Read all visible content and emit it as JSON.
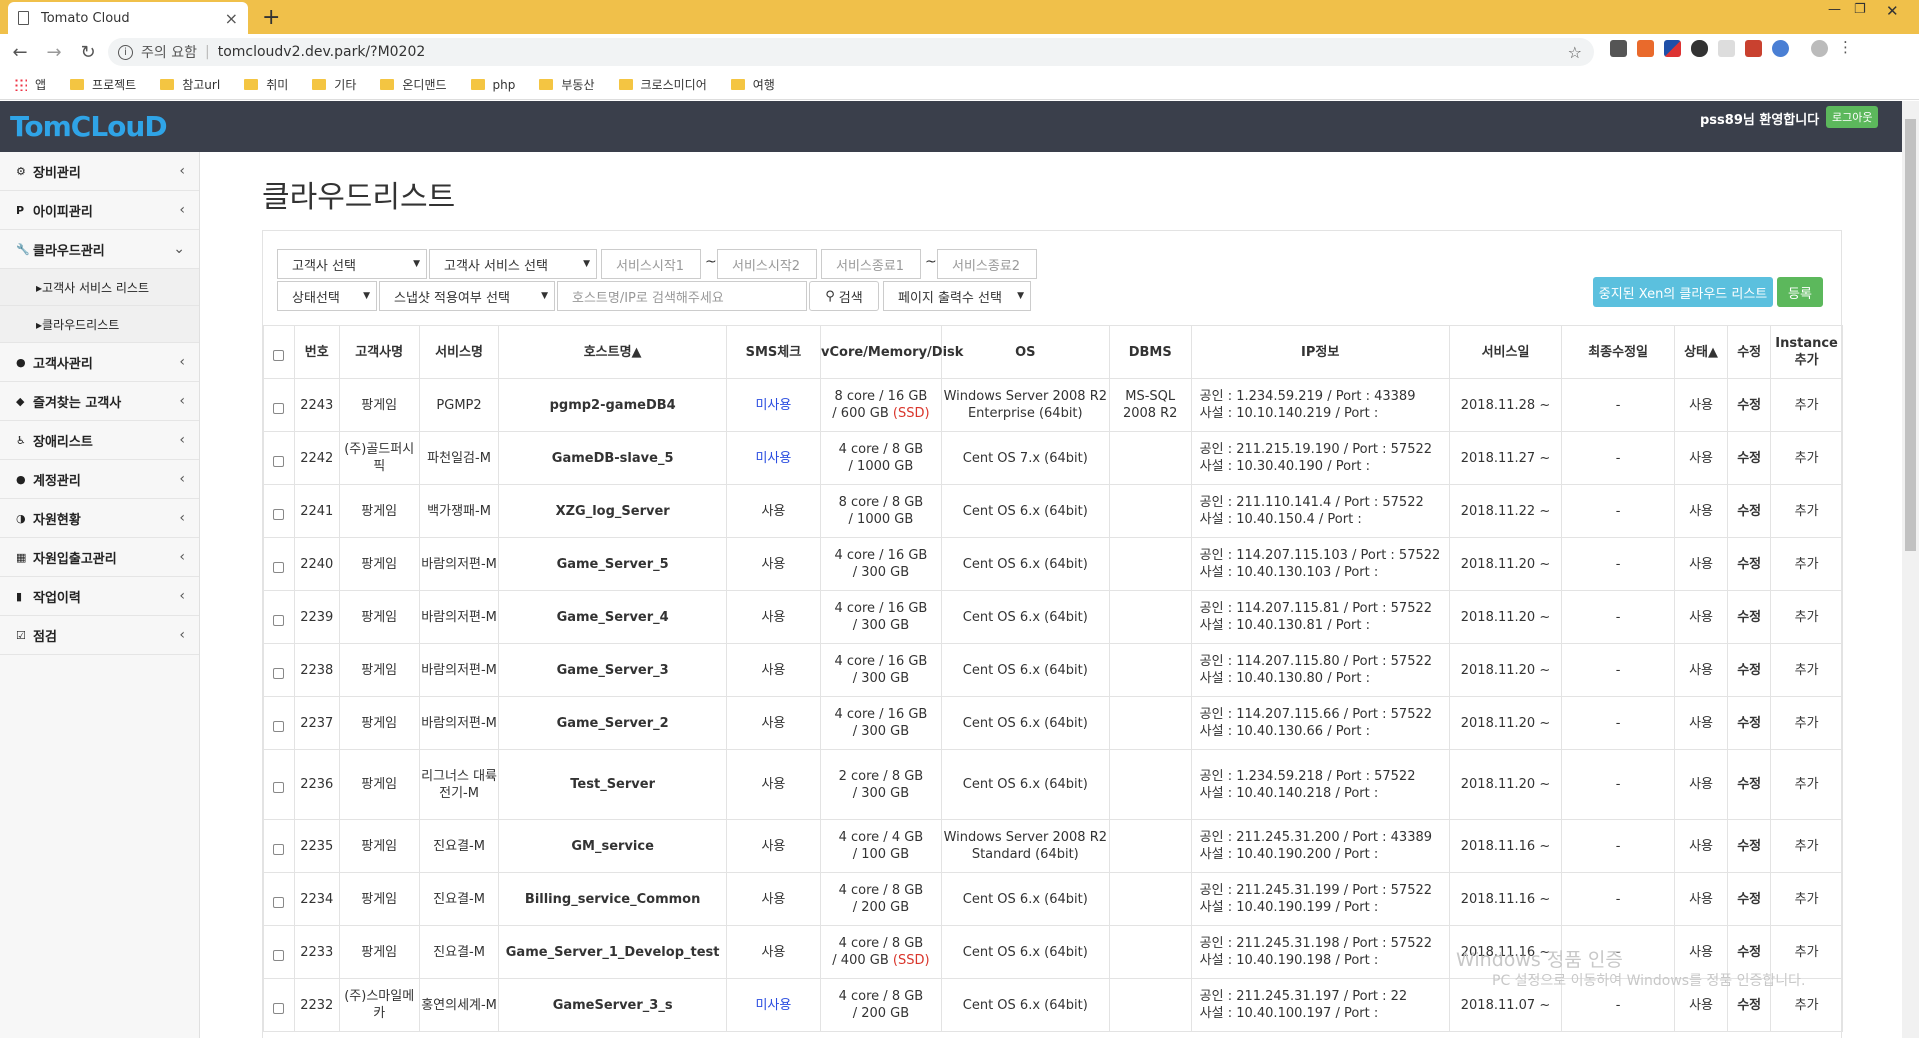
{
  "browser": {
    "tab_title": "Tomato Cloud",
    "omnibox": {
      "warning": "주의 요함",
      "url": "tomcloudv2.dev.park/?M0202"
    },
    "bookmarks": [
      "앱",
      "프로젝트",
      "참고url",
      "취미",
      "기타",
      "온디맨드",
      "php",
      "부동산",
      "크로스미디어",
      "여행"
    ]
  },
  "header": {
    "logo": "TomCLouD",
    "welcome": "pss89님 환영합니다",
    "logout": "로그아웃"
  },
  "sidebar": {
    "items": [
      {
        "icon": "gear-icon",
        "glyph": "⚙",
        "label": "장비관리",
        "chev": "‹"
      },
      {
        "icon": "ip-icon",
        "glyph": "P",
        "label": "아이피관리",
        "chev": "‹"
      },
      {
        "icon": "wrench-icon",
        "glyph": "🔧",
        "label": "클라우드관리",
        "chev": "⌄"
      },
      {
        "icon": "user-icon",
        "glyph": "●",
        "label": "고객사관리",
        "chev": "‹"
      },
      {
        "icon": "cube-icon",
        "glyph": "◆",
        "label": "즐겨찾는 고객사",
        "chev": "‹"
      },
      {
        "icon": "wheelchair-icon",
        "glyph": "♿",
        "label": "장애리스트",
        "chev": "‹"
      },
      {
        "icon": "account-icon",
        "glyph": "●",
        "label": "계정관리",
        "chev": "‹"
      },
      {
        "icon": "pie-icon",
        "glyph": "◑",
        "label": "자원현황",
        "chev": "‹"
      },
      {
        "icon": "calendar-icon",
        "glyph": "▦",
        "label": "자원입출고관리",
        "chev": "‹"
      },
      {
        "icon": "book-icon",
        "glyph": "▮",
        "label": "작업이력",
        "chev": "‹"
      },
      {
        "icon": "check-icon",
        "glyph": "☑",
        "label": "점검",
        "chev": "‹"
      }
    ],
    "submenu": [
      "▸고객사 서비스 리스트",
      "▸클라우드리스트"
    ]
  },
  "page": {
    "title": "클라우드리스트",
    "filters": {
      "customer_select": "고객사 선택",
      "service_select": "고객사 서비스 선택",
      "service_start1": "서비스시작1",
      "service_start2": "서비스시작2",
      "service_end1": "서비스종료1",
      "service_end2": "서비스종료2",
      "tilde": "~",
      "status_select": "상태선택",
      "snapshot_select": "스냅샷 적용여부 선택",
      "search_placeholder": "호스트명/IP로 검색해주세요",
      "search_button": "검색",
      "page_size_select": "페이지 출력수 선택",
      "xen_button": "중지된 Xen의 클라우드 리스트",
      "register_button": "등록"
    },
    "columns": [
      "번호",
      "고객사명",
      "서비스명",
      "호스트명▲",
      "SMS체크",
      "vCore/Memory/Disk",
      "OS",
      "DBMS",
      "IP정보",
      "서비스일",
      "최종수정일",
      "상태▲",
      "수정",
      "Instance 추가"
    ],
    "rows": [
      {
        "no": "2243",
        "customer": "팡게임",
        "service": "PGMP2",
        "host": "pgmp2-gameDB4",
        "sms": "미사용",
        "spec1": "8 core / 16 GB",
        "spec2": "/ 600 GB",
        "ssd": "(SSD)",
        "os": "Windows Server 2008 R2 Enterprise (64bit)",
        "dbms": "MS-SQL 2008 R2",
        "ip1": "공인 : 1.234.59.219 / Port : 43389",
        "ip2": "사설 : 10.10.140.219 / Port :",
        "date": "2018.11.28 ~",
        "modified": "-",
        "status": "사용",
        "edit": "수정",
        "add": "추가"
      },
      {
        "no": "2242",
        "customer": "(주)골드퍼시픽",
        "service": "파천일검-M",
        "host": "GameDB-slave_5",
        "sms": "미사용",
        "spec1": "4 core / 8 GB",
        "spec2": "/ 1000 GB",
        "ssd": "",
        "os": "Cent OS 7.x (64bit)",
        "dbms": "",
        "ip1": "공인 : 211.215.19.190 / Port : 57522",
        "ip2": "사설 : 10.30.40.190 / Port :",
        "date": "2018.11.27 ~",
        "modified": "-",
        "status": "사용",
        "edit": "수정",
        "add": "추가"
      },
      {
        "no": "2241",
        "customer": "팡게임",
        "service": "백가쟁패-M",
        "host": "XZG_log_Server",
        "sms": "사용",
        "spec1": "8 core / 8 GB",
        "spec2": "/ 1000 GB",
        "ssd": "",
        "os": "Cent OS 6.x (64bit)",
        "dbms": "",
        "ip1": "공인 : 211.110.141.4 / Port : 57522",
        "ip2": "사설 : 10.40.150.4 / Port :",
        "date": "2018.11.22 ~",
        "modified": "-",
        "status": "사용",
        "edit": "수정",
        "add": "추가"
      },
      {
        "no": "2240",
        "customer": "팡게임",
        "service": "바람의저편-M",
        "host": "Game_Server_5",
        "sms": "사용",
        "spec1": "4 core / 16 GB",
        "spec2": "/ 300 GB",
        "ssd": "",
        "os": "Cent OS 6.x (64bit)",
        "dbms": "",
        "ip1": "공인 : 114.207.115.103 / Port : 57522",
        "ip2": "사설 : 10.40.130.103 / Port :",
        "date": "2018.11.20 ~",
        "modified": "-",
        "status": "사용",
        "edit": "수정",
        "add": "추가"
      },
      {
        "no": "2239",
        "customer": "팡게임",
        "service": "바람의저편-M",
        "host": "Game_Server_4",
        "sms": "사용",
        "spec1": "4 core / 16 GB",
        "spec2": "/ 300 GB",
        "ssd": "",
        "os": "Cent OS 6.x (64bit)",
        "dbms": "",
        "ip1": "공인 : 114.207.115.81 / Port : 57522",
        "ip2": "사설 : 10.40.130.81 / Port :",
        "date": "2018.11.20 ~",
        "modified": "-",
        "status": "사용",
        "edit": "수정",
        "add": "추가"
      },
      {
        "no": "2238",
        "customer": "팡게임",
        "service": "바람의저편-M",
        "host": "Game_Server_3",
        "sms": "사용",
        "spec1": "4 core / 16 GB",
        "spec2": "/ 300 GB",
        "ssd": "",
        "os": "Cent OS 6.x (64bit)",
        "dbms": "",
        "ip1": "공인 : 114.207.115.80 / Port : 57522",
        "ip2": "사설 : 10.40.130.80 / Port :",
        "date": "2018.11.20 ~",
        "modified": "-",
        "status": "사용",
        "edit": "수정",
        "add": "추가"
      },
      {
        "no": "2237",
        "customer": "팡게임",
        "service": "바람의저편-M",
        "host": "Game_Server_2",
        "sms": "사용",
        "spec1": "4 core / 16 GB",
        "spec2": "/ 300 GB",
        "ssd": "",
        "os": "Cent OS 6.x (64bit)",
        "dbms": "",
        "ip1": "공인 : 114.207.115.66 / Port : 57522",
        "ip2": "사설 : 10.40.130.66 / Port :",
        "date": "2018.11.20 ~",
        "modified": "-",
        "status": "사용",
        "edit": "수정",
        "add": "추가"
      },
      {
        "no": "2236",
        "customer": "팡게임",
        "service": "리그너스 대륙전기-M",
        "host": "Test_Server",
        "sms": "사용",
        "spec1": "2 core / 8 GB",
        "spec2": "/ 300 GB",
        "ssd": "",
        "os": "Cent OS 6.x (64bit)",
        "dbms": "",
        "ip1": "공인 : 1.234.59.218 / Port : 57522",
        "ip2": "사설 : 10.40.140.218 / Port :",
        "date": "2018.11.20 ~",
        "modified": "-",
        "status": "사용",
        "edit": "수정",
        "add": "추가"
      },
      {
        "no": "2235",
        "customer": "팡게임",
        "service": "진요결-M",
        "host": "GM_service",
        "sms": "사용",
        "spec1": "4 core / 4 GB",
        "spec2": "/ 100 GB",
        "ssd": "",
        "os": "Windows Server 2008 R2 Standard (64bit)",
        "dbms": "",
        "ip1": "공인 : 211.245.31.200 / Port : 43389",
        "ip2": "사설 : 10.40.190.200 / Port :",
        "date": "2018.11.16 ~",
        "modified": "-",
        "status": "사용",
        "edit": "수정",
        "add": "추가"
      },
      {
        "no": "2234",
        "customer": "팡게임",
        "service": "진요결-M",
        "host": "Billing_service_Common",
        "sms": "사용",
        "spec1": "4 core / 8 GB",
        "spec2": "/ 200 GB",
        "ssd": "",
        "os": "Cent OS 6.x (64bit)",
        "dbms": "",
        "ip1": "공인 : 211.245.31.199 / Port : 57522",
        "ip2": "사설 : 10.40.190.199 / Port :",
        "date": "2018.11.16 ~",
        "modified": "-",
        "status": "사용",
        "edit": "수정",
        "add": "추가"
      },
      {
        "no": "2233",
        "customer": "팡게임",
        "service": "진요결-M",
        "host": "Game_Server_1_Develop_test",
        "sms": "사용",
        "spec1": "4 core / 8 GB",
        "spec2": "/ 400 GB",
        "ssd": "(SSD)",
        "os": "Cent OS 6.x (64bit)",
        "dbms": "",
        "ip1": "공인 : 211.245.31.198 / Port : 57522",
        "ip2": "사설 : 10.40.190.198 / Port :",
        "date": "2018.11.16 ~",
        "modified": "-",
        "status": "사용",
        "edit": "수정",
        "add": "추가"
      },
      {
        "no": "2232",
        "customer": "(주)스마일메카",
        "service": "홍연의세계-M",
        "host": "GameServer_3_s",
        "sms": "미사용",
        "spec1": "4 core / 8 GB",
        "spec2": "/ 200 GB",
        "ssd": "",
        "os": "Cent OS 6.x (64bit)",
        "dbms": "",
        "ip1": "공인 : 211.245.31.197 / Port : 22",
        "ip2": "사설 : 10.40.100.197 / Port :",
        "date": "2018.11.07 ~",
        "modified": "-",
        "status": "사용",
        "edit": "수정",
        "add": "추가"
      }
    ]
  },
  "watermark": {
    "line1": "Windows 정품 인증",
    "line2": "PC 설정으로 이동하여 Windows를 정품 인증합니다."
  }
}
